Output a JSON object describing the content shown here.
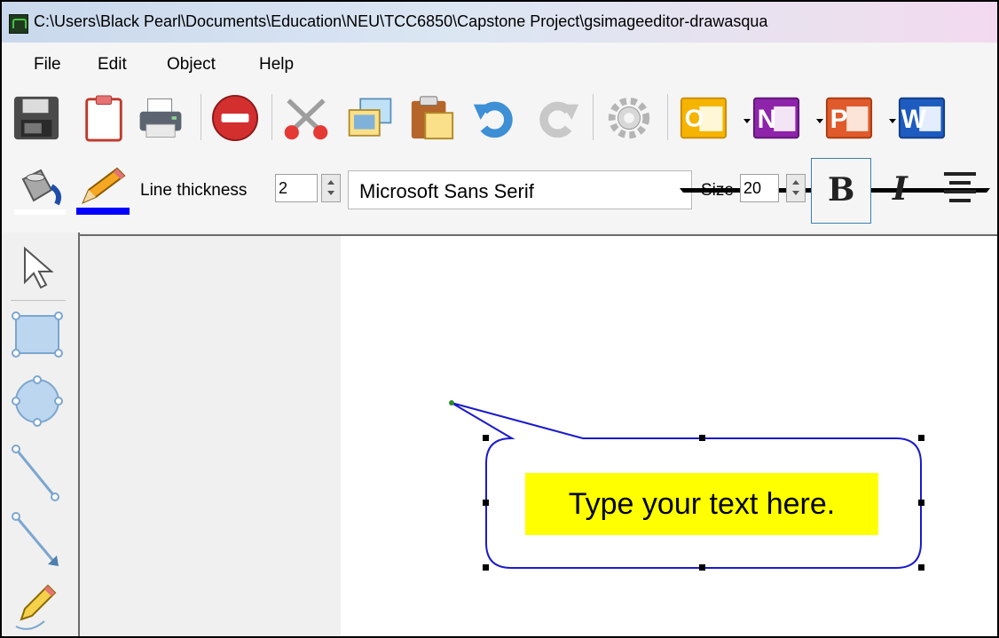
{
  "window": {
    "title": "C:\\Users\\Black Pearl\\Documents\\Education\\NEU\\TCC6850\\Capstone Project\\gsimageeditor-drawasqua"
  },
  "menu": {
    "items": [
      {
        "label": "File"
      },
      {
        "label": "Edit"
      },
      {
        "label": "Object"
      },
      {
        "label": "Help"
      }
    ]
  },
  "toolbar": {
    "icons": [
      "save-icon",
      "clipboard-icon",
      "print-icon",
      "delete-icon",
      "cut-icon",
      "copy-icon",
      "paste-icon",
      "undo-icon",
      "redo-icon",
      "settings-icon",
      "outlook-icon",
      "onenote-icon",
      "powerpoint-icon",
      "word-icon"
    ],
    "app_letters": {
      "outlook": "O",
      "onenote": "N",
      "powerpoint": "P",
      "word": "W"
    }
  },
  "format": {
    "fill_color": "#ffffff",
    "line_color": "#0000ff",
    "line_thickness_label": "Line thickness",
    "line_thickness": "2",
    "font_name": "Microsoft Sans Serif",
    "size_label": "Size",
    "font_size": "20",
    "bold_label": "B",
    "italic_label": "I"
  },
  "tools": [
    "pointer-tool-icon",
    "rectangle-tool-icon",
    "ellipse-tool-icon",
    "line-tool-icon",
    "arrow-tool-icon",
    "pencil-tool-icon"
  ],
  "canvas": {
    "callout_text": "Type your text here.",
    "callout_border_color": "#1a1acc",
    "highlight_color": "#ffff00"
  }
}
